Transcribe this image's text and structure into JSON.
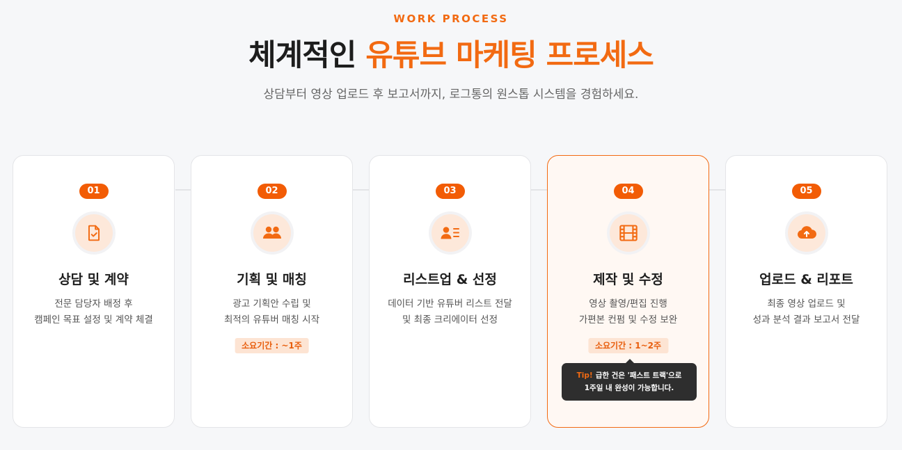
{
  "header": {
    "eyebrow": "WORK PROCESS",
    "title_main": "체계적인 ",
    "title_accent": "유튜브 마케팅 프로세스",
    "subtitle": "상담부터 영상 업로드 후 보고서까지, 로그통의 원스톱 시스템을 경험하세요."
  },
  "colors": {
    "accent": "#f26a12",
    "badge": "#f25c05",
    "highlight_bg": "#fff8f3",
    "tooltip_bg": "#2e2e2e"
  },
  "steps": [
    {
      "number": "01",
      "icon": "document-check-icon",
      "title": "상담 및 계약",
      "desc_line1": "전문 담당자 배정 후",
      "desc_line2": "캠페인 목표 설정 및 계약 체결"
    },
    {
      "number": "02",
      "icon": "users-icon",
      "title": "기획 및 매칭",
      "desc_line1": "광고 기획안 수립 및",
      "desc_line2": "최적의 유튜버 매칭 시작",
      "duration": "소요기간 : ~1주"
    },
    {
      "number": "03",
      "icon": "user-list-icon",
      "title": "리스트업 & 선정",
      "desc_line1": "데이터 기반 유튜버 리스트 전달",
      "desc_line2": "및 최종 크리에이터 선정"
    },
    {
      "number": "04",
      "icon": "film-icon",
      "title": "제작 및 수정",
      "desc_line1": "영상 촬영/편집 진행",
      "desc_line2": "가편본 컨펌 및 수정 보완",
      "duration": "소요기간 : 1~2주",
      "tip_label": "Tip!",
      "tip_line1": "급한 건은 '패스트 트랙'으로",
      "tip_line2": "1주일 내 완성이 가능합니다."
    },
    {
      "number": "05",
      "icon": "cloud-upload-icon",
      "title": "업로드 & 리포트",
      "desc_line1": "최종 영상 업로드 및",
      "desc_line2": "성과 분석 결과 보고서 전달"
    }
  ]
}
